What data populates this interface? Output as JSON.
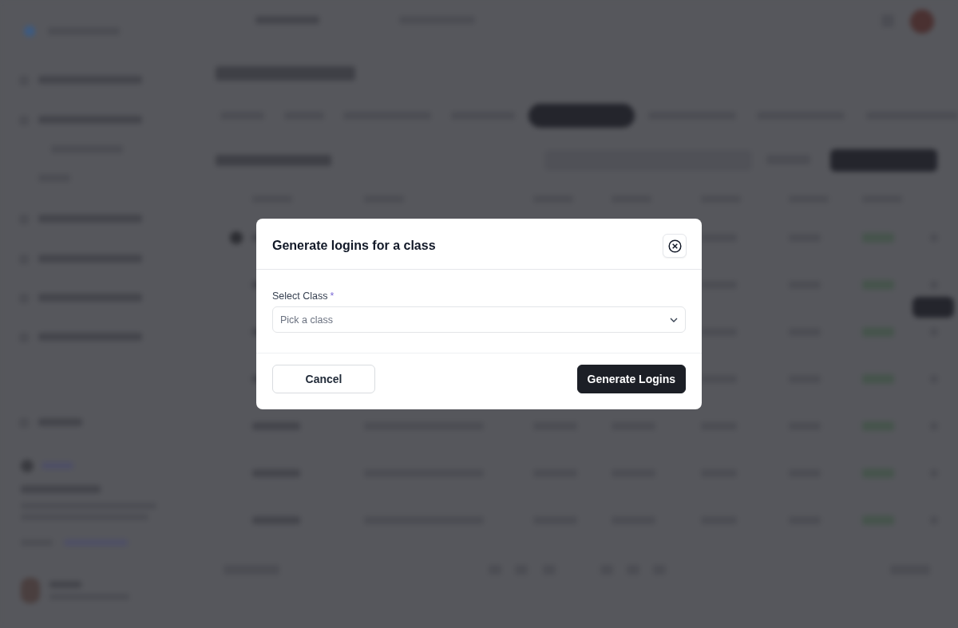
{
  "dialog": {
    "title": "Generate logins for a class",
    "field": {
      "label": "Select Class",
      "required_mark": "*",
      "placeholder": "Pick a class"
    },
    "buttons": [
      {
        "label": "Cancel",
        "kind": "secondary"
      },
      {
        "label": "Generate Logins",
        "kind": "primary"
      }
    ]
  }
}
